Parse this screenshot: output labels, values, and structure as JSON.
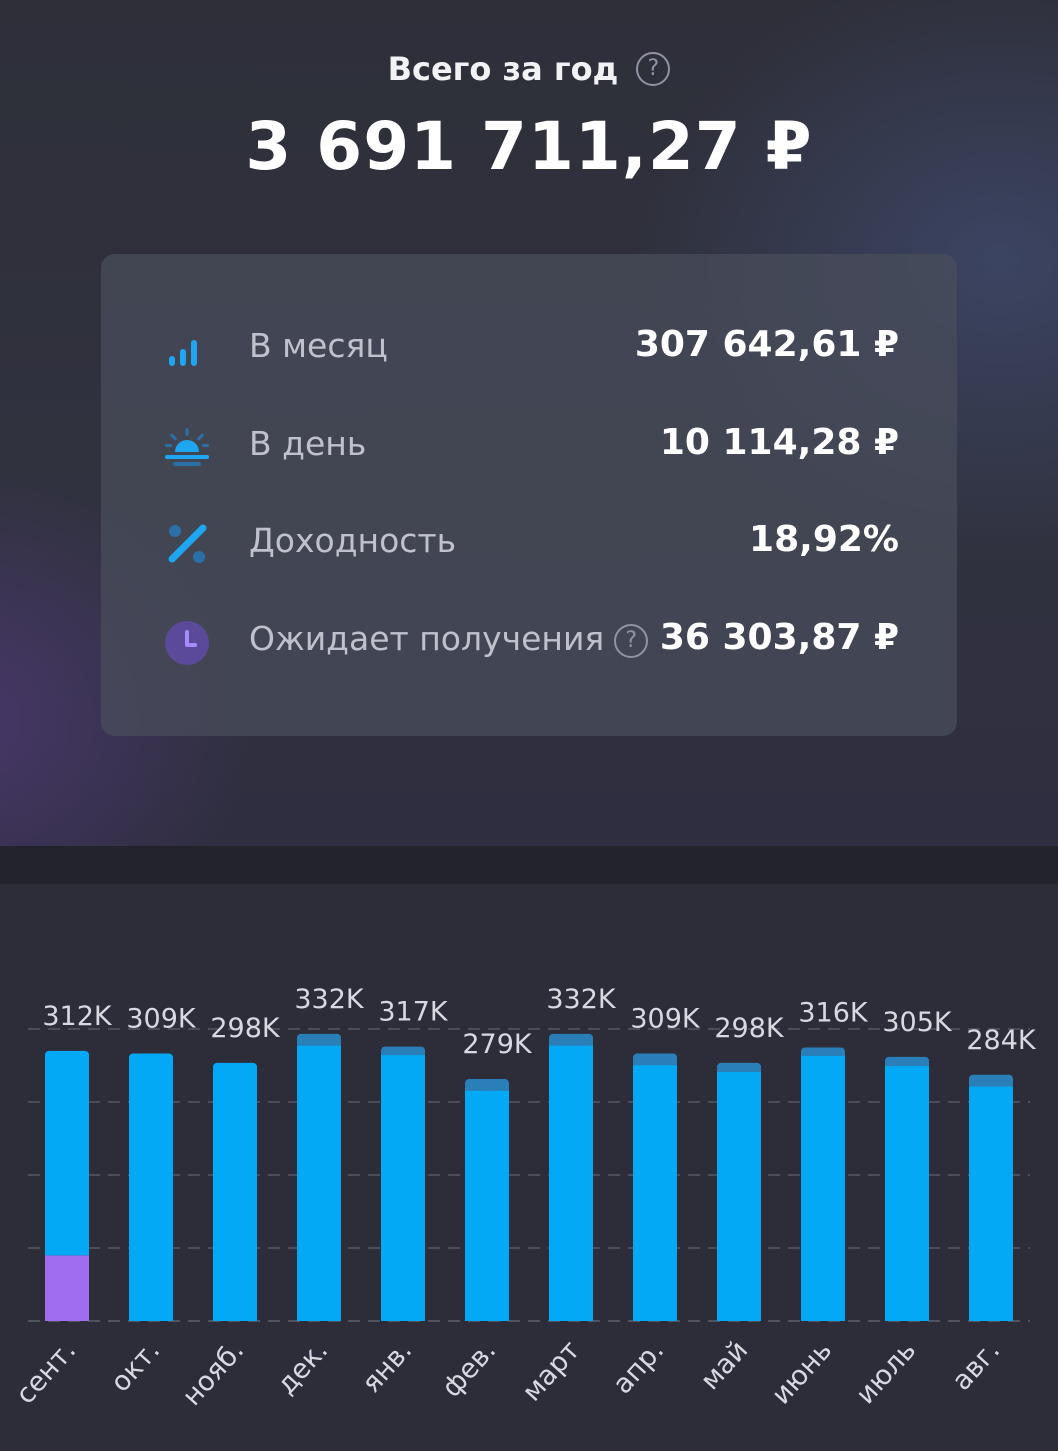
{
  "header": {
    "title": "Всего за год",
    "total": "3 691 711,27 ₽"
  },
  "stats": [
    {
      "label": "В месяц",
      "value": "307 642,61 ₽",
      "icon": "bar-chart-icon"
    },
    {
      "label": "В день",
      "value": "10 114,28 ₽",
      "icon": "sunrise-icon"
    },
    {
      "label": "Доходность",
      "value": "18,92%",
      "icon": "percent-icon"
    },
    {
      "label": "Ожидает получения",
      "value": "36 303,87 ₽",
      "icon": "clock-icon"
    }
  ],
  "colors": {
    "bar": "#03a9f4",
    "bar_top": "#2a7fb8",
    "pending": "#a06cf0",
    "accent_blue": "#1ea7f0",
    "clock_bg": "#5b4a9a"
  },
  "chart_data": {
    "type": "bar",
    "categories": [
      "сент.",
      "окт.",
      "нояб.",
      "дек.",
      "янв.",
      "фев.",
      "март",
      "апр.",
      "май",
      "июнь",
      "июль",
      "авг."
    ],
    "value_labels": [
      "312K",
      "309K",
      "298K",
      "332K",
      "317K",
      "279K",
      "332K",
      "309K",
      "298K",
      "316K",
      "305K",
      "284K"
    ],
    "series": [
      {
        "values": [
          235,
          309,
          298,
          324,
          313,
          271,
          324,
          301,
          293,
          312,
          300,
          276
        ]
      },
      {
        "values": [
          77,
          0,
          0,
          0,
          0,
          0,
          0,
          0,
          0,
          0,
          0,
          0
        ]
      },
      {
        "values": [
          0,
          0,
          0,
          8,
          4,
          8,
          8,
          8,
          5,
          4,
          5,
          8
        ]
      }
    ],
    "ylim": [
      0,
      340
    ],
    "grid": true
  }
}
